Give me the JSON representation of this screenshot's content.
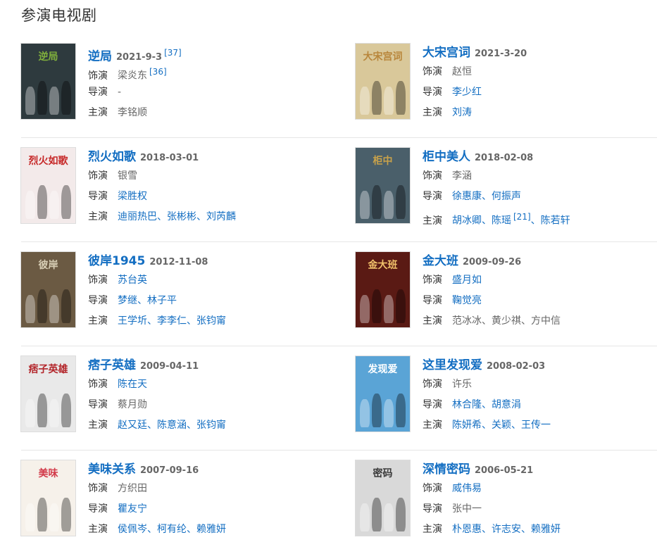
{
  "section_title": "参演电视剧",
  "labels": {
    "role": "饰演",
    "director": "导演",
    "cast": "主演"
  },
  "separator": "、",
  "shows": [
    {
      "name": "逆局",
      "date": "2021-9-3",
      "ref": "[37]",
      "role": "梁炎东",
      "role_ref": "[36]",
      "director": "-",
      "cast": "李铭顺",
      "poster": {
        "bg": "#2e3a3e",
        "accent": "#7fae3c",
        "art": "逆局"
      }
    },
    {
      "name": "大宋宫词",
      "date": "2021-3-20",
      "role": "赵恒",
      "director": "李少红",
      "cast": "刘涛",
      "poster": {
        "bg": "#d9c89a",
        "accent": "#b8863b",
        "art": "大宋宫词"
      }
    },
    {
      "name": "烈火如歌",
      "date": "2018-03-01",
      "role": "银雪",
      "director": "梁胜权",
      "cast": "迪丽热巴、张彬彬、刘芮麟",
      "poster": {
        "bg": "#f3eaea",
        "accent": "#c62828",
        "art": "烈火如歌"
      }
    },
    {
      "name": "柜中美人",
      "date": "2018-02-08",
      "role": "李涵",
      "director": "徐惠康、何振声",
      "cast": "胡冰卿、陈瑶",
      "cast_ref": "[21]",
      "cast_tail": "、陈若轩",
      "poster": {
        "bg": "#4a5f6a",
        "accent": "#c9a24a",
        "art": "柜中"
      }
    },
    {
      "name": "彼岸1945",
      "date": "2012-11-08",
      "role": "苏台英",
      "director": "梦继、林子平",
      "cast": "王学圻、李李仁、张钧甯",
      "poster": {
        "bg": "#6b5a43",
        "accent": "#d8cfb6",
        "art": "彼岸"
      }
    },
    {
      "name": "金大班",
      "date": "2009-09-26",
      "role": "盛月如",
      "director": "鞠觉亮",
      "cast": "范冰冰、黄少祺、方中信",
      "poster": {
        "bg": "#5a1a14",
        "accent": "#f2c26b",
        "art": "金大班"
      }
    },
    {
      "name": "痞子英雄",
      "date": "2009-04-11",
      "role": "陈在天",
      "director": "蔡月勋",
      "cast": "赵又廷、陈意涵、张钧甯",
      "poster": {
        "bg": "#e9e9e9",
        "accent": "#b3262b",
        "art": "痞子英雄"
      }
    },
    {
      "name": "这里发现爱",
      "date": "2008-02-03",
      "role": "许乐",
      "director": "林合隆、胡意涓",
      "cast": "陈妍希、关颖、王传一",
      "poster": {
        "bg": "#5aa4d6",
        "accent": "#ffffff",
        "art": "发现爱"
      }
    },
    {
      "name": "美味关系",
      "date": "2007-09-16",
      "role": "方织田",
      "director": "瞿友宁",
      "cast": "侯佩岑、柯有纶、赖雅妍",
      "poster": {
        "bg": "#f6f1ea",
        "accent": "#d23b4a",
        "art": "美味"
      }
    },
    {
      "name": "深情密码",
      "date": "2006-05-21",
      "role": "威伟易",
      "director": "张中一",
      "cast": "朴恩惠、许志安、赖雅妍",
      "poster": {
        "bg": "#d9d9d9",
        "accent": "#3a3a3a",
        "art": "密码"
      }
    }
  ]
}
